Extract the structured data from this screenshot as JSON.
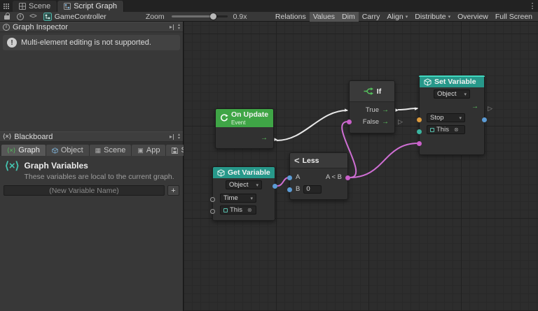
{
  "window": {
    "tabs": [
      {
        "label": "Scene"
      },
      {
        "label": "Script Graph"
      }
    ]
  },
  "toolbar": {
    "asset_name": "GameController",
    "zoom_label": "Zoom",
    "zoom_value": "0.9x",
    "buttons": [
      {
        "label": "Relations",
        "active": false
      },
      {
        "label": "Values",
        "active": true
      },
      {
        "label": "Dim",
        "active": true
      },
      {
        "label": "Carry",
        "active": false
      },
      {
        "label": "Align",
        "dropdown": true
      },
      {
        "label": "Distribute",
        "dropdown": true
      },
      {
        "label": "Overview",
        "active": false
      },
      {
        "label": "Full Screen",
        "active": false
      }
    ]
  },
  "inspector": {
    "title": "Graph Inspector",
    "warning": "Multi-element editing is not supported."
  },
  "blackboard": {
    "title": "Blackboard",
    "tabs": [
      {
        "label": "Graph"
      },
      {
        "label": "Object"
      },
      {
        "label": "Scene"
      },
      {
        "label": "App"
      },
      {
        "label": "Saved"
      }
    ],
    "section_title": "Graph Variables",
    "section_desc": "These variables are local to the current graph.",
    "new_variable_placeholder": "(New Variable Name)",
    "add_label": "+"
  },
  "graph": {
    "nodes": {
      "on_update": {
        "title": "On Update",
        "subtitle": "Event"
      },
      "get_variable": {
        "title": "Get Variable",
        "kind": "Object",
        "name": "Time",
        "target": "This"
      },
      "less": {
        "title": "Less",
        "a": "A",
        "b": "B",
        "b_value": "0",
        "output": "A < B"
      },
      "if": {
        "title": "If",
        "true": "True",
        "false": "False"
      },
      "set_variable": {
        "title": "Set Variable",
        "kind": "Object",
        "name": "Stop",
        "target": "This"
      }
    }
  },
  "icons": {
    "menu": "⋮",
    "info": "i",
    "exclaim": "!",
    "code": "<>",
    "caret_down": "▾",
    "caret_up": "▴",
    "arrow_right": "→",
    "tri_filled": "▸",
    "tri_hollow": "▷",
    "remove_target": "⊗",
    "less_than": "<",
    "variables": "⟨×⟩",
    "plus": "+"
  },
  "colors": {
    "event_green": "#3fa546",
    "variable_teal": "#27988a",
    "wire_white": "#e8e8e8",
    "wire_magenta": "#cf6fd4",
    "port_blue": "#5b9bd5",
    "port_magenta": "#c95fc9",
    "port_orange": "#de9b3c",
    "port_teal": "#3ab5a0",
    "selection_teal": "#41d9c0"
  }
}
